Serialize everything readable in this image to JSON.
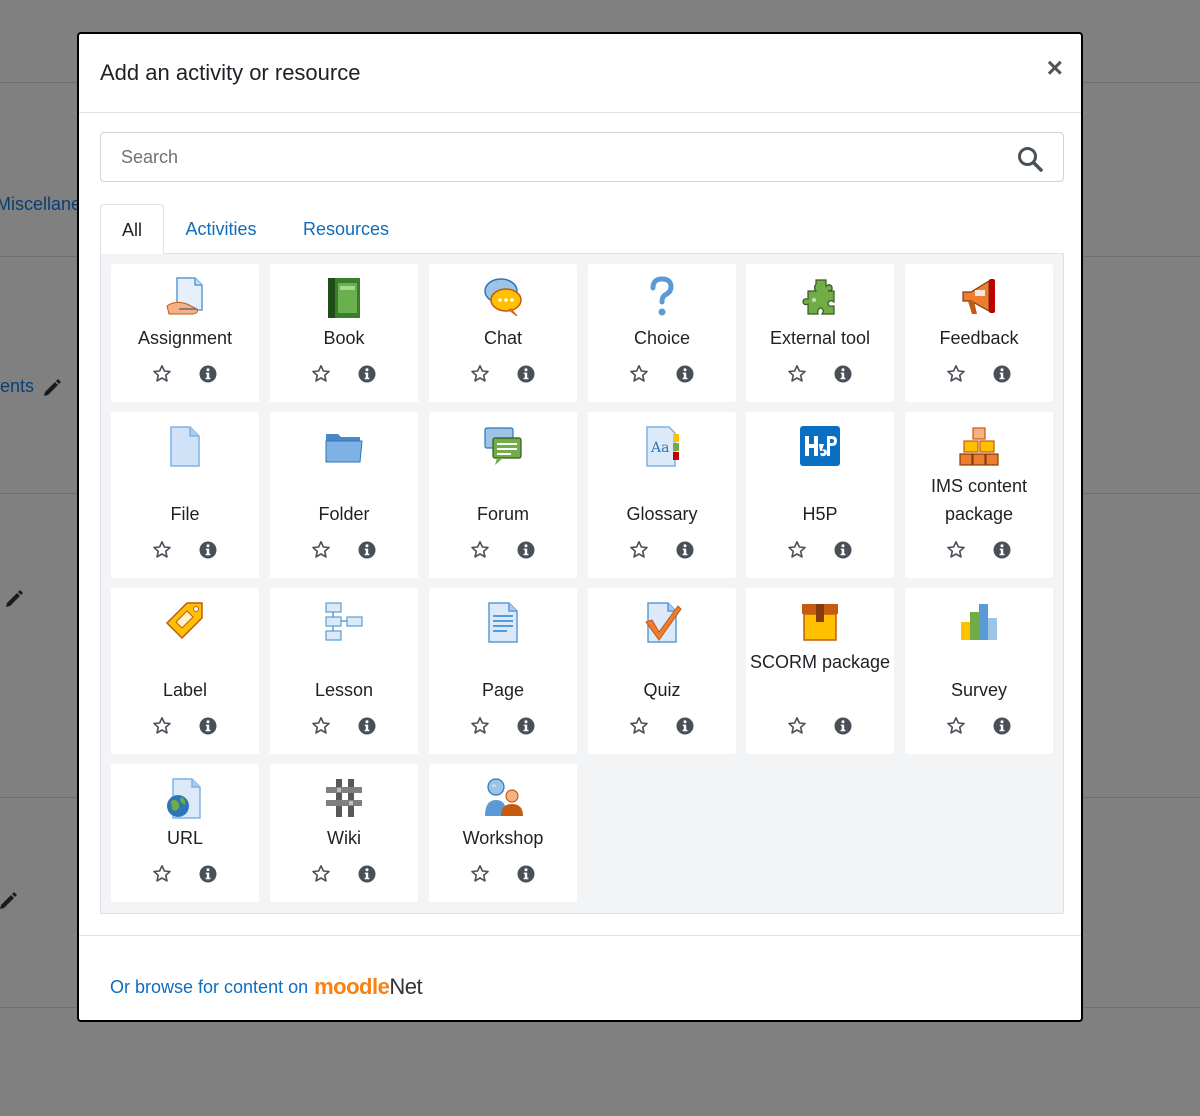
{
  "background": {
    "section_label": "Miscellane",
    "partial_label": "ents"
  },
  "modal": {
    "title": "Add an activity or resource",
    "close_symbol": "×",
    "search": {
      "placeholder": "Search",
      "value": ""
    },
    "tabs": [
      {
        "label": "All",
        "active": true
      },
      {
        "label": "Activities",
        "active": false
      },
      {
        "label": "Resources",
        "active": false
      }
    ],
    "items": [
      {
        "name": "Assignment",
        "icon": "assignment-icon"
      },
      {
        "name": "Book",
        "icon": "book-icon"
      },
      {
        "name": "Chat",
        "icon": "chat-icon"
      },
      {
        "name": "Choice",
        "icon": "choice-icon"
      },
      {
        "name": "External tool",
        "icon": "external-tool-icon"
      },
      {
        "name": "Feedback",
        "icon": "feedback-icon"
      },
      {
        "name": "File",
        "icon": "file-icon"
      },
      {
        "name": "Folder",
        "icon": "folder-icon"
      },
      {
        "name": "Forum",
        "icon": "forum-icon"
      },
      {
        "name": "Glossary",
        "icon": "glossary-icon"
      },
      {
        "name": "H5P",
        "icon": "h5p-icon"
      },
      {
        "name": "IMS content package",
        "icon": "ims-package-icon"
      },
      {
        "name": "Label",
        "icon": "label-icon"
      },
      {
        "name": "Lesson",
        "icon": "lesson-icon"
      },
      {
        "name": "Page",
        "icon": "page-icon"
      },
      {
        "name": "Quiz",
        "icon": "quiz-icon"
      },
      {
        "name": "SCORM package",
        "icon": "scorm-icon"
      },
      {
        "name": "Survey",
        "icon": "survey-icon"
      },
      {
        "name": "URL",
        "icon": "url-icon"
      },
      {
        "name": "Wiki",
        "icon": "wiki-icon"
      },
      {
        "name": "Workshop",
        "icon": "workshop-icon"
      }
    ],
    "footer": {
      "link_text": "Or browse for content on",
      "logo_moodle": "moodle",
      "logo_net": "Net"
    }
  },
  "colors": {
    "link": "#0f6cbf",
    "overlay": "#808080",
    "moodle_orange": "#f98012"
  }
}
